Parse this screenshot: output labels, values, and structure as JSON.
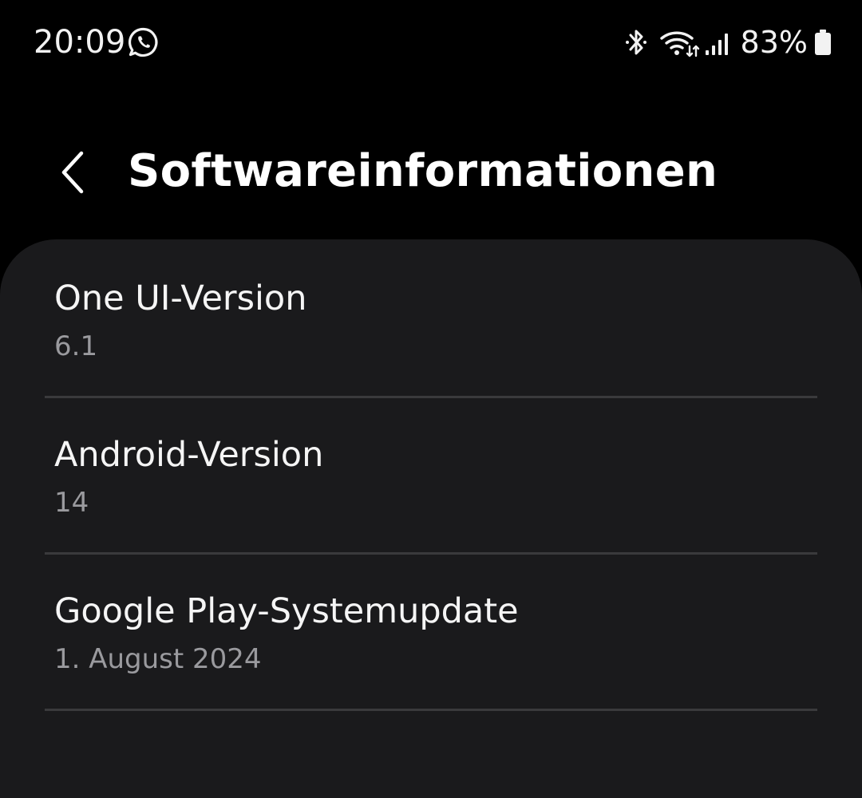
{
  "status_bar": {
    "time": "20:09",
    "battery_percent": "83%",
    "icons": [
      "whatsapp-icon",
      "bluetooth-icon",
      "wifi-icon",
      "signal-icon",
      "battery-icon"
    ]
  },
  "header": {
    "back_icon": "chevron-left-icon",
    "title": "Softwareinformationen"
  },
  "items": [
    {
      "label": "One UI-Version",
      "value": "6.1"
    },
    {
      "label": "Android-Version",
      "value": "14"
    },
    {
      "label": "Google Play-Systemupdate",
      "value": "1. August 2024"
    }
  ],
  "colors": {
    "background": "#000000",
    "card": "#1a1a1c",
    "title_text": "#ffffff",
    "secondary_text": "#9a9a9e",
    "divider": "#3a3a3c"
  }
}
